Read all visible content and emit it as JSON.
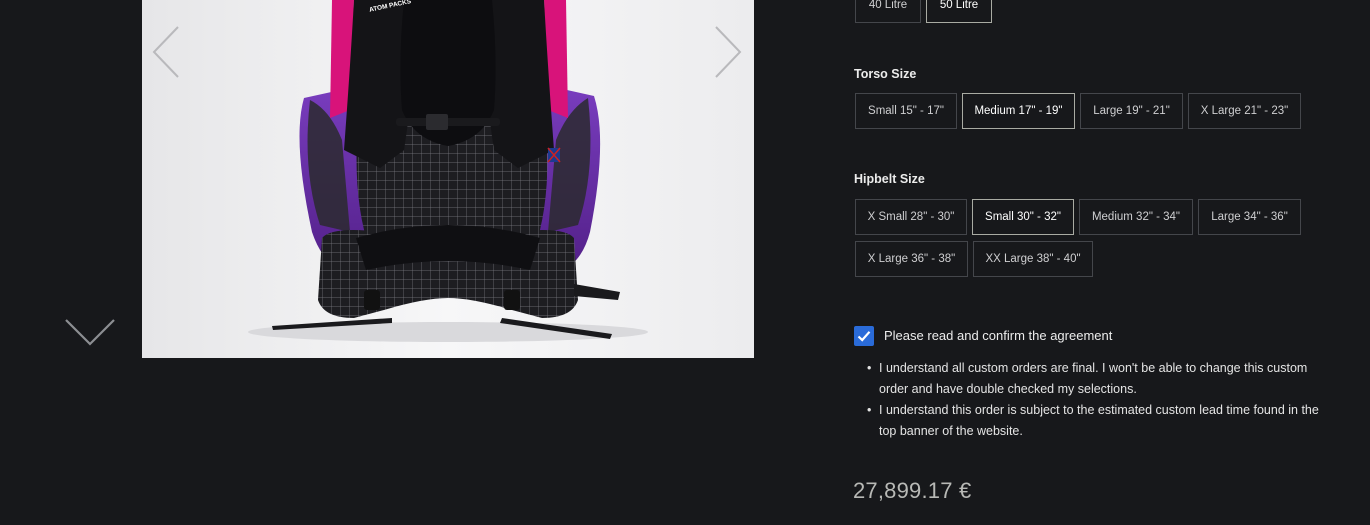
{
  "capacity": {
    "options": [
      {
        "label": "40 Litre",
        "selected": false
      },
      {
        "label": "50 Litre",
        "selected": true
      }
    ]
  },
  "torso": {
    "label": "Torso Size",
    "options": [
      {
        "label": "Small 15\" - 17\"",
        "selected": false
      },
      {
        "label": "Medium 17\" - 19\"",
        "selected": true
      },
      {
        "label": "Large 19\" - 21\"",
        "selected": false
      },
      {
        "label": "X Large 21\" - 23\"",
        "selected": false
      }
    ]
  },
  "hipbelt": {
    "label": "Hipbelt Size",
    "options": [
      {
        "label": "X Small 28\" - 30\"",
        "selected": false
      },
      {
        "label": "Small 30\" - 32\"",
        "selected": true
      },
      {
        "label": "Medium 32\" - 34\"",
        "selected": false
      },
      {
        "label": "Large 34\" - 36\"",
        "selected": false
      },
      {
        "label": "X Large 36\" - 38\"",
        "selected": false
      },
      {
        "label": "XX Large 38\" - 40\"",
        "selected": false
      }
    ]
  },
  "agreement": {
    "checked": true,
    "title": "Please read and confirm the agreement",
    "items": [
      "I understand all custom orders are final. I won't be able to change this custom order and have double checked my selections.",
      "I understand this order is subject to the estimated custom lead time found in the top banner of the website."
    ]
  },
  "price": "27,899.17 €",
  "product_image": {
    "brand_mark": "ATOM PACKS"
  },
  "icons": {
    "gallery_prev": "chevron-left-icon",
    "gallery_next": "chevron-right-icon",
    "thumbs_down": "chevron-down-icon",
    "check": "check-icon"
  },
  "colors": {
    "background": "#17181b",
    "checkbox": "#2a6bd9",
    "selected_border": "#a9aba3",
    "pack_body": "#6a2fa3",
    "pack_strap": "#d8137a"
  }
}
